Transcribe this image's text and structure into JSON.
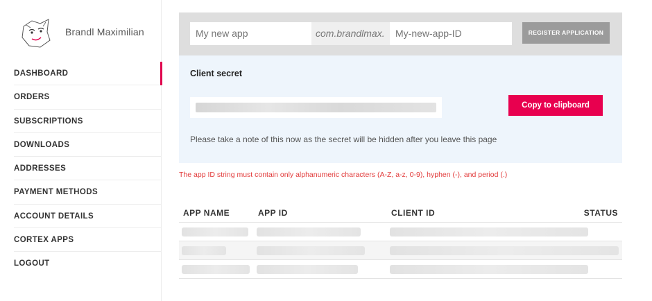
{
  "profile": {
    "name": "Brandl Maximilian"
  },
  "nav": {
    "items": [
      {
        "label": "DASHBOARD",
        "active": true
      },
      {
        "label": "ORDERS"
      },
      {
        "label": "SUBSCRIPTIONS"
      },
      {
        "label": "DOWNLOADS"
      },
      {
        "label": "ADDRESSES"
      },
      {
        "label": "PAYMENT METHODS"
      },
      {
        "label": "ACCOUNT DETAILS"
      },
      {
        "label": "CORTEX APPS"
      },
      {
        "label": "LOGOUT"
      }
    ]
  },
  "register": {
    "name_placeholder": "My new app",
    "domain_prefix": "com.brandlmax.",
    "id_placeholder": "My-new-app-ID",
    "button_label": "REGISTER APPLICATION"
  },
  "secret": {
    "title": "Client secret",
    "copy_button": "Copy to clipboard",
    "note": "Please take a note of this now as the secret will be hidden after you leave this page"
  },
  "error": {
    "message": "The app ID string must contain only alphanumeric characters (A-Z, a-z, 0-9), hyphen (-), and period (.)"
  },
  "table": {
    "headers": {
      "app_name": "APP NAME",
      "app_id": "APP ID",
      "client_id": "CLIENT ID",
      "status": "STATUS"
    }
  },
  "colors": {
    "accent": "#e8004f",
    "register_bar": "#dedede",
    "secret_panel": "#eef5fc",
    "error": "#e23b3b"
  }
}
